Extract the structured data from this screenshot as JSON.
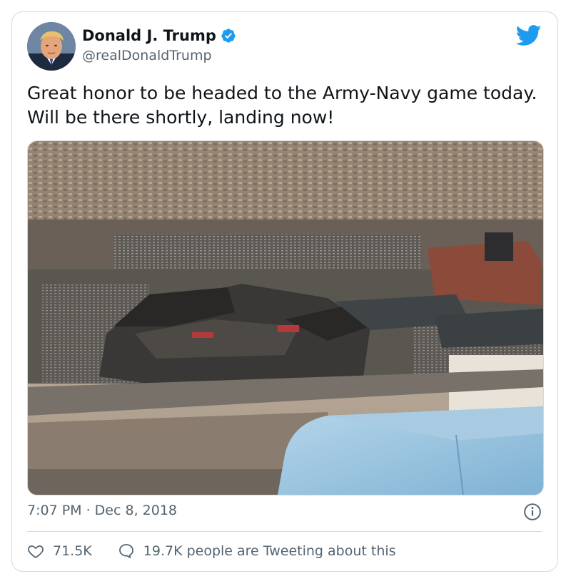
{
  "tweet": {
    "author": {
      "display_name": "Donald J. Trump",
      "handle": "@realDonaldTrump",
      "avatar_icon": "avatar-photo",
      "verified_icon": "verified-badge-icon"
    },
    "text": "Great honor to be headed to the Army-Navy game today. Will be there shortly, landing now!",
    "media": {
      "kind": "photo",
      "subject": "aerial-stadium-photo"
    },
    "timestamp": "7:07 PM · Dec 8, 2018",
    "stats": {
      "likes": "71.5K",
      "conversation": "19.7K people are Tweeting about this"
    }
  },
  "colors": {
    "brand_blue": "#1d9bf0",
    "text_primary": "#0f1419",
    "text_secondary": "#536471",
    "border": "#cfd9de"
  }
}
